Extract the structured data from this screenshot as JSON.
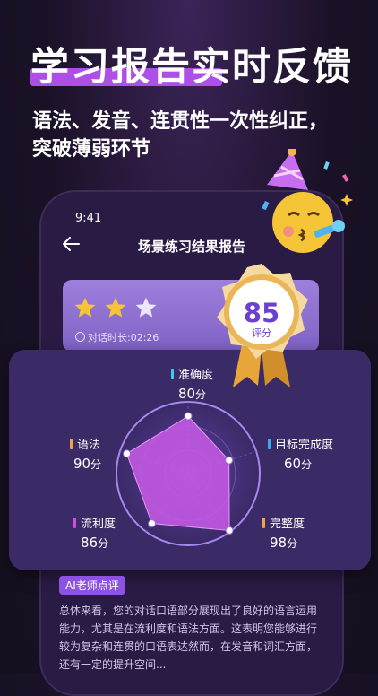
{
  "promo": {
    "headline": "学习报告实时反馈",
    "subheadline": "语法、发音、连贯性一次性纠正，突破薄弱环节"
  },
  "phone": {
    "status_time": "9:41",
    "title": "场景练习结果报告",
    "stars": {
      "filled": 2,
      "total": 3
    },
    "duration": "对话时长:02:26",
    "score": "85",
    "score_label": "评分"
  },
  "metrics": [
    {
      "name": "准确度",
      "value": "80",
      "unit": "分",
      "score": 80,
      "color": "#3fc7ef"
    },
    {
      "name": "目标完成度",
      "value": "60",
      "unit": "分",
      "score": 60,
      "color": "#3fa7ef"
    },
    {
      "name": "完整度",
      "value": "98",
      "unit": "分",
      "score": 98,
      "color": "#f0a340"
    },
    {
      "name": "流利度",
      "value": "86",
      "unit": "分",
      "score": 86,
      "color": "#d24be0"
    },
    {
      "name": "语法",
      "value": "90",
      "unit": "分",
      "score": 90,
      "color": "#f0a340"
    }
  ],
  "ai": {
    "badge": "AI老师点评",
    "text": "总体来看，您的对话口语部分展现出了良好的语言运用能力，尤其是在流利度和语法方面。这表明您能够进行较为复杂和连贯的口语表达然而，在发音和词汇方面，还有一定的提升空间..."
  },
  "icons": {
    "back": "back-arrow-icon",
    "star": "star-icon",
    "clock": "clock-icon",
    "medal": "medal-icon",
    "emoji": "party-emoji-icon"
  },
  "colors": {
    "accent": "#b552f0",
    "card": "#3a2a66",
    "star": "#f6c437"
  }
}
